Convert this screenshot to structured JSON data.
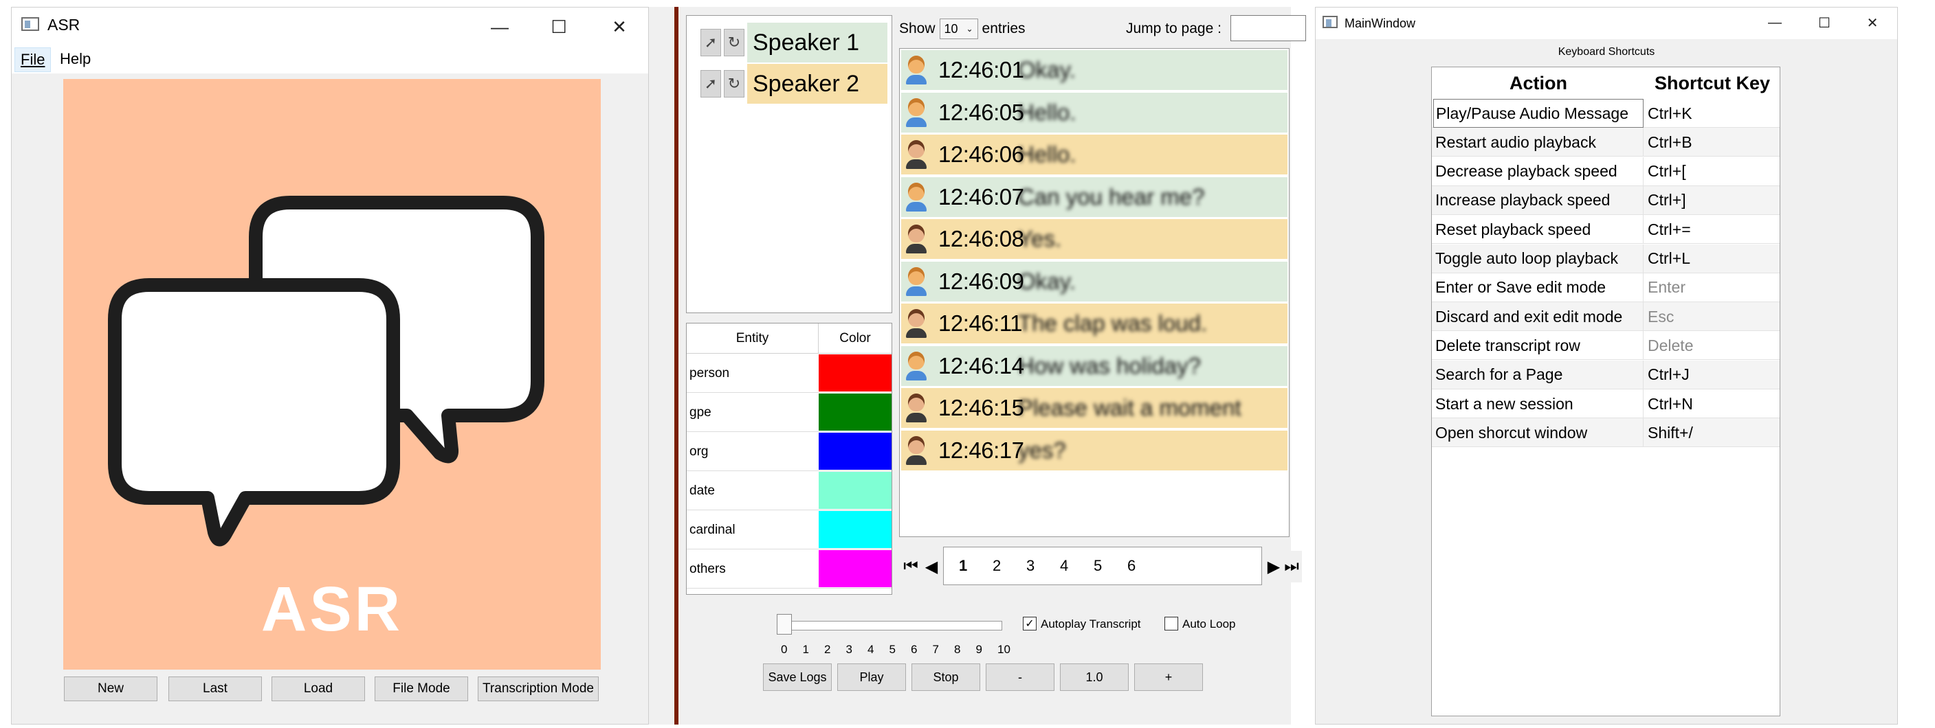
{
  "asr_window": {
    "title": "ASR",
    "menu": [
      "File",
      "Help"
    ],
    "logo_text": "ASR",
    "buttons": [
      "New",
      "Last",
      "Load",
      "File Mode",
      "Transcription Mode"
    ]
  },
  "transcript_panel": {
    "speakers": [
      {
        "name": "Speaker 1",
        "color": "#dcebdc"
      },
      {
        "name": "Speaker 2",
        "color": "#f7dfa8"
      }
    ],
    "entity_table": {
      "headers": [
        "Entity",
        "Color"
      ],
      "rows": [
        {
          "entity": "person",
          "color": "#ff0000"
        },
        {
          "entity": "gpe",
          "color": "#008000"
        },
        {
          "entity": "org",
          "color": "#0000ff"
        },
        {
          "entity": "date",
          "color": "#7fffd4"
        },
        {
          "entity": "cardinal",
          "color": "#00ffff"
        },
        {
          "entity": "others",
          "color": "#ff00ff"
        }
      ]
    },
    "show_label": "Show",
    "entries_count": "10",
    "entries_label": "entries",
    "jump_label": "Jump to page :",
    "jump_value": "",
    "rows": [
      {
        "speaker": 1,
        "time": "12:46:01",
        "text": "Okay."
      },
      {
        "speaker": 1,
        "time": "12:46:05",
        "text": "Hello."
      },
      {
        "speaker": 2,
        "time": "12:46:06",
        "text": "Hello."
      },
      {
        "speaker": 1,
        "time": "12:46:07",
        "text": "Can you hear me?"
      },
      {
        "speaker": 2,
        "time": "12:46:08",
        "text": "Yes."
      },
      {
        "speaker": 1,
        "time": "12:46:09",
        "text": "Okay."
      },
      {
        "speaker": 2,
        "time": "12:46:11",
        "text": "The clap was loud."
      },
      {
        "speaker": 1,
        "time": "12:46:14",
        "text": "How was holiday?"
      },
      {
        "speaker": 2,
        "time": "12:46:15",
        "text": "Please wait a moment"
      },
      {
        "speaker": 2,
        "time": "12:46:17",
        "text": "yes?"
      }
    ],
    "pages": [
      "1",
      "2",
      "3",
      "4",
      "5",
      "6"
    ],
    "slider_ticks": [
      "0",
      "1",
      "2",
      "3",
      "4",
      "5",
      "6",
      "7",
      "8",
      "9",
      "10"
    ],
    "slider_value": 0,
    "autoplay_label": "Autoplay Transcript",
    "autoplay_checked": true,
    "autoloop_label": "Auto Loop",
    "autoloop_checked": false,
    "controls": [
      "Save Logs",
      "Play",
      "Stop",
      "-",
      "1.0",
      "+"
    ]
  },
  "main_window": {
    "title": "MainWindow",
    "section_label": "Keyboard Shortcuts",
    "headers": [
      "Action",
      "Shortcut Key"
    ],
    "shortcuts": [
      {
        "action": "Play/Pause Audio Message",
        "key": "Ctrl+K",
        "dim": false
      },
      {
        "action": "Restart audio playback",
        "key": "Ctrl+B",
        "dim": false
      },
      {
        "action": "Decrease playback speed",
        "key": "Ctrl+[",
        "dim": false
      },
      {
        "action": "Increase playback speed",
        "key": "Ctrl+]",
        "dim": false
      },
      {
        "action": "Reset playback speed",
        "key": "Ctrl+=",
        "dim": false
      },
      {
        "action": "Toggle auto loop playback",
        "key": "Ctrl+L",
        "dim": false
      },
      {
        "action": "Enter or Save edit mode",
        "key": "Enter",
        "dim": true
      },
      {
        "action": "Discard and exit edit mode",
        "key": "Esc",
        "dim": true
      },
      {
        "action": "Delete transcript row",
        "key": "Delete",
        "dim": true
      },
      {
        "action": "Search for a Page",
        "key": "Ctrl+J",
        "dim": false
      },
      {
        "action": "Start a new session",
        "key": "Ctrl+N",
        "dim": false
      },
      {
        "action": "Open shorcut window",
        "key": "Shift+/",
        "dim": false
      }
    ]
  }
}
